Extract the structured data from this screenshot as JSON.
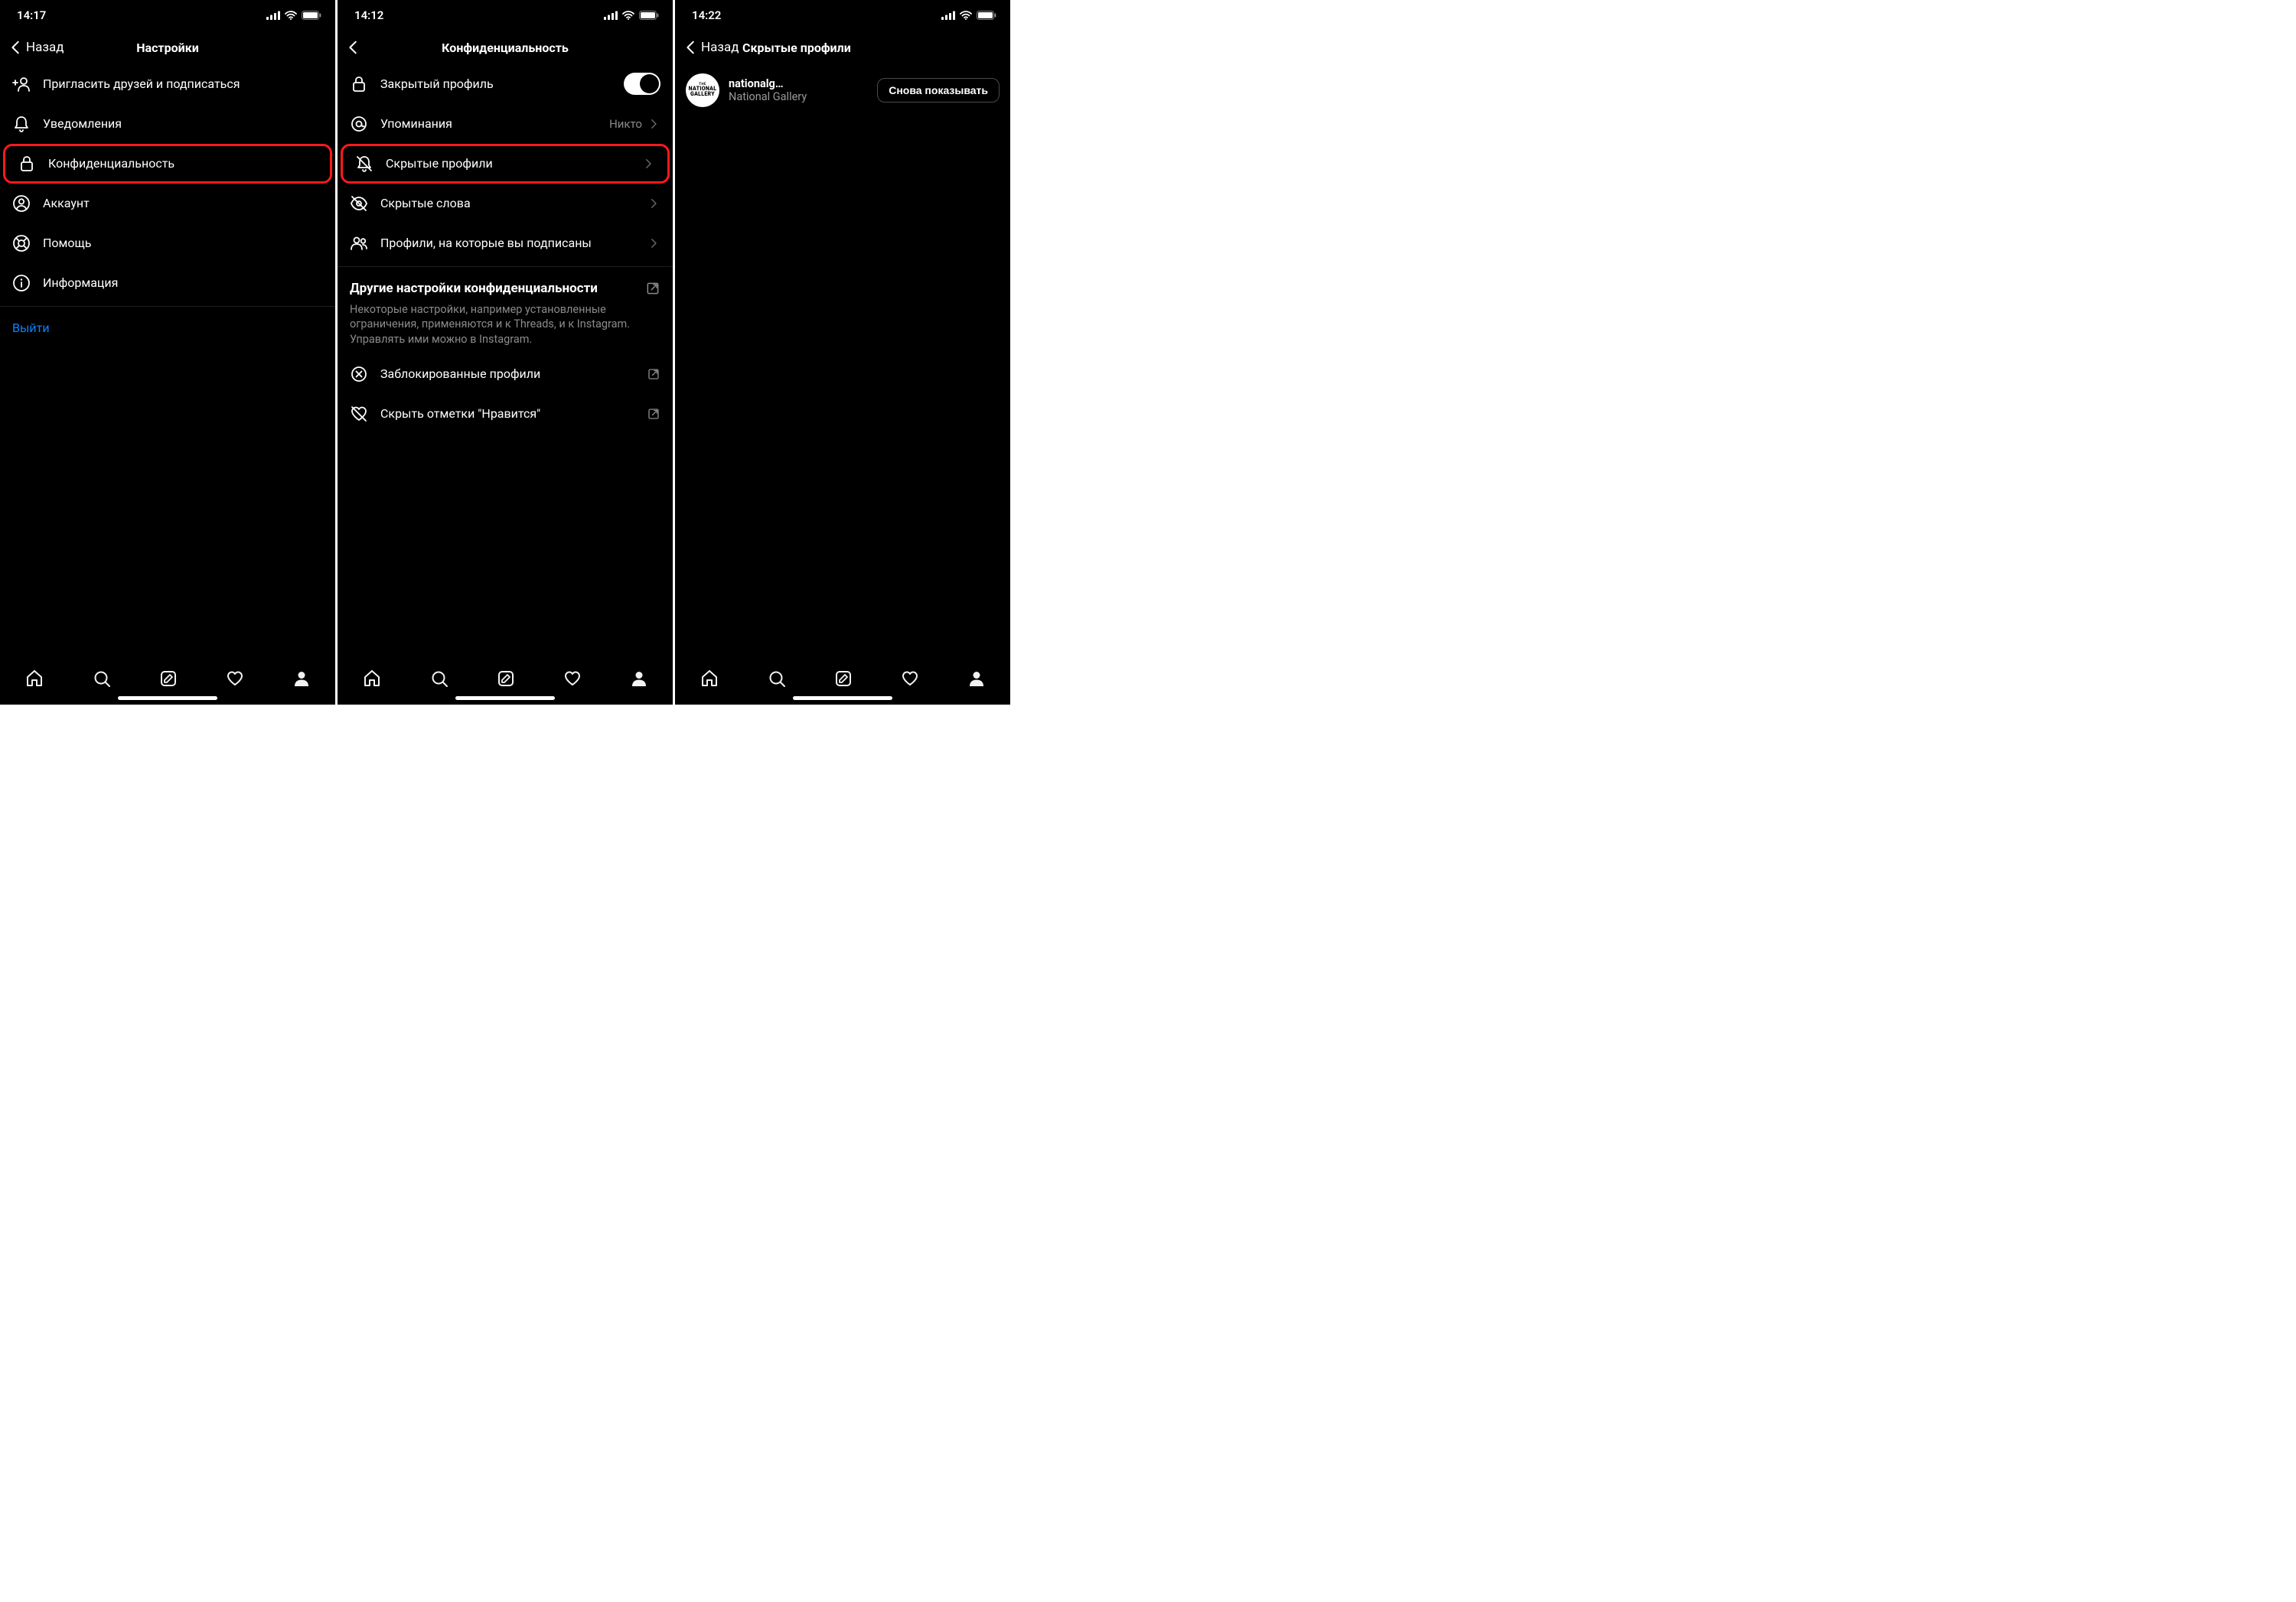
{
  "screens": [
    {
      "status_time": "14:17",
      "back_label": "Назад",
      "title": "Настройки",
      "rows": [
        {
          "icon": "add-user",
          "label": "Пригласить друзей и подписаться"
        },
        {
          "icon": "bell",
          "label": "Уведомления"
        },
        {
          "icon": "lock",
          "label": "Конфиденциальность",
          "highlight": true
        },
        {
          "icon": "account",
          "label": "Аккаунт"
        },
        {
          "icon": "lifebuoy",
          "label": "Помощь"
        },
        {
          "icon": "info",
          "label": "Информация"
        }
      ],
      "logout": "Выйти"
    },
    {
      "status_time": "14:12",
      "back_label": "",
      "title": "Конфиденциальность",
      "rows": [
        {
          "icon": "lock",
          "label": "Закрытый профиль",
          "toggle": true
        },
        {
          "icon": "mention",
          "label": "Упоминания",
          "trail_text": "Никто",
          "chevron": true
        },
        {
          "icon": "bell-off",
          "label": "Скрытые профили",
          "chevron": true,
          "highlight": true
        },
        {
          "icon": "eye-off",
          "label": "Скрытые слова",
          "chevron": true
        },
        {
          "icon": "people",
          "label": "Профили, на которые вы подписаны",
          "chevron": true
        }
      ],
      "section": {
        "title": "Другие настройки конфиденциальности",
        "desc": "Некоторые настройки, например установленные ограничения, применяются и к Threads, и к Instagram. Управлять ими можно в Instagram."
      },
      "extra_rows": [
        {
          "icon": "x-circle",
          "label": "Заблокированные профили",
          "external": true
        },
        {
          "icon": "heart-off",
          "label": "Скрыть отметки \"Нравится\"",
          "external": true
        }
      ]
    },
    {
      "status_time": "14:22",
      "back_label": "Назад",
      "title": "Скрытые профили",
      "profile": {
        "username": "nationalg…",
        "fullname": "National Gallery",
        "avatar_l1": "THE",
        "avatar_l2": "NATIONAL",
        "avatar_l3": "GALLERY",
        "button": "Снова показывать"
      }
    }
  ],
  "tabs": [
    "home",
    "search",
    "compose",
    "heart",
    "profile"
  ]
}
